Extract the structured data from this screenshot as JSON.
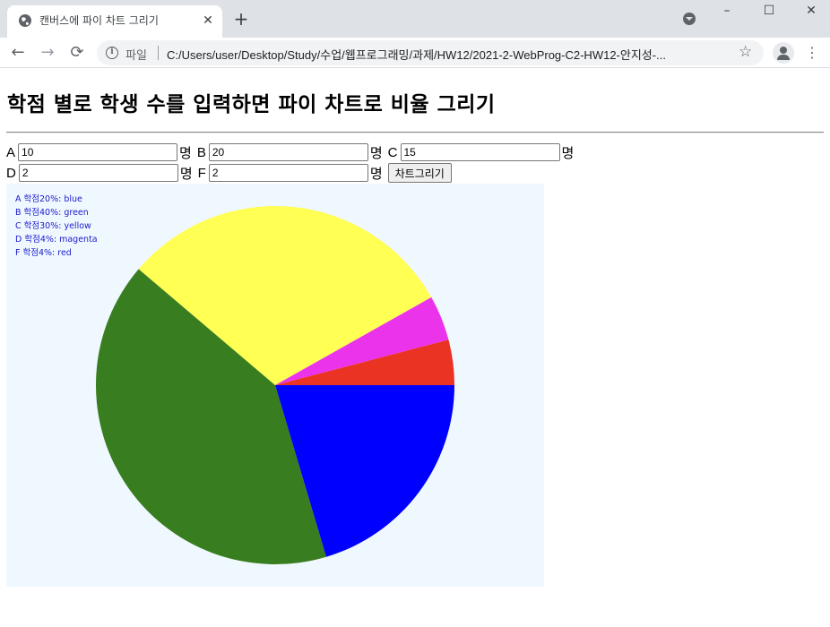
{
  "browser": {
    "tab_title": "캔버스에 파이 차트 그리기",
    "tab_close": "✕",
    "new_tab": "+",
    "window_minimize": "–",
    "window_maximize": "☐",
    "window_close": "✕",
    "back": "←",
    "forward": "→",
    "reload": "⟳",
    "address_label": "파일",
    "url": "C:/Users/user/Desktop/Study/수업/웹프로그래밍/과제/HW12/2021-2-WebProg-C2-HW12-안지성-...",
    "star": "☆",
    "menu": "⋮"
  },
  "page": {
    "title": "학점 별로 학생 수를 입력하면 파이 차트로 비율 그리기",
    "unit": "명",
    "grades": [
      {
        "label": "A",
        "value": "10"
      },
      {
        "label": "B",
        "value": "20"
      },
      {
        "label": "C",
        "value": "15"
      },
      {
        "label": "D",
        "value": "2"
      },
      {
        "label": "F",
        "value": "2"
      }
    ],
    "draw_button": "차트그리기"
  },
  "chart_data": {
    "type": "pie",
    "legend": [
      "A 학점20%: blue",
      "B 학점40%: green",
      "C 학점30%: yellow",
      "D 학점4%: magenta",
      "F 학점4%: red"
    ],
    "slices": [
      {
        "label": "A",
        "value": 10,
        "percent": 20,
        "color": "#0000ff"
      },
      {
        "label": "B",
        "value": 20,
        "percent": 40,
        "color": "#387d1f"
      },
      {
        "label": "C",
        "value": 15,
        "percent": 30,
        "color": "#ffff54"
      },
      {
        "label": "D",
        "value": 2,
        "percent": 4,
        "color": "#eb33eb"
      },
      {
        "label": "F",
        "value": 2,
        "percent": 4,
        "color": "#ea3323"
      }
    ]
  }
}
